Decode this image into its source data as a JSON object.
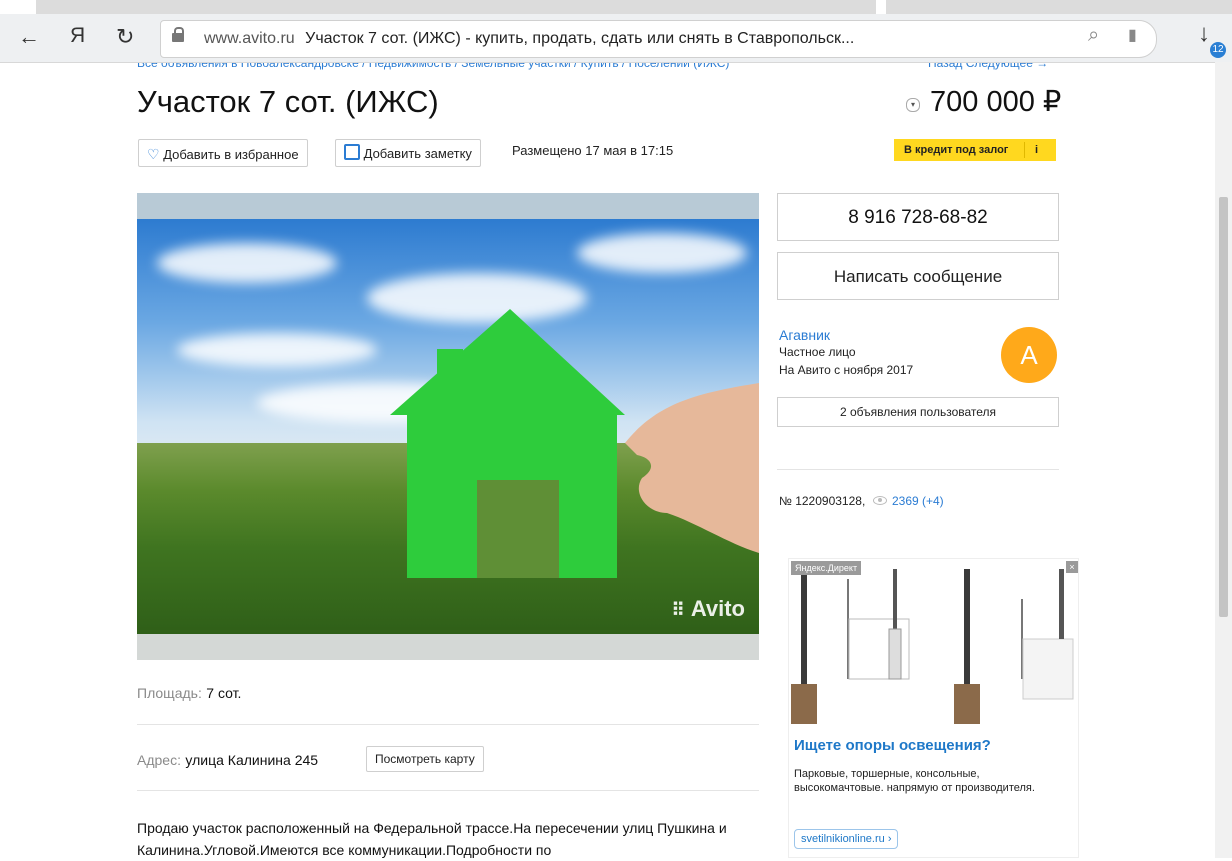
{
  "browser": {
    "back_icon": "←",
    "yandex_logo": "Я",
    "reload_icon": "↻",
    "url_domain": "www.avito.ru",
    "page_title": "Участок 7 сот. (ИЖС) - купить, продать, сдать или снять в Ставропольск...",
    "search_icon": "⌕",
    "bookmark_icon": "▮",
    "download_icon": "↓",
    "download_count": "12"
  },
  "page": {
    "breadcrumbs": "Все объявления в Новоалександровске / Недвижимость / Земельные участки / Купить / Поселений (ИЖС)",
    "nav": "Назад  Следующее →",
    "title": "Участок 7 сот. (ИЖС)",
    "price": "700 000 ₽",
    "price_toggle": "▾",
    "favorite_label": "Добавить в избранное",
    "note_label": "Добавить заметку",
    "posted": "Размещено 17 мая в 17:15",
    "credit_label": "В кредит под залог",
    "credit_info": "i",
    "photo_watermark": "Avito",
    "area_label": "Площадь:",
    "area_value": "7 сот.",
    "address_label": "Адрес:",
    "address_value": "улица Калинина 245",
    "map_button": "Посмотреть карту",
    "description": "Продаю участок расположенный на Федеральной трассе.На пересечении улиц Пушкина и Калинина.Угловой.Имеются все коммуникации.Подробности по"
  },
  "seller": {
    "phone": "8 916 728-68-82",
    "message_button": "Написать сообщение",
    "name": "Агавник",
    "type": "Частное лицо",
    "since": "На Авито с ноября 2017",
    "avatar_letter": "А",
    "ads_button": "2 объявления пользователя",
    "ad_number": "№ 1220903128,",
    "views": "2369 (+4)"
  },
  "ad": {
    "tag": "Яндекс.Директ",
    "close": "×",
    "title": "Ищете опоры освещения?",
    "text": "Парковые, торшерные, консольные, высокомачтовые. напрямую от производителя.",
    "link": "svetilnikionline.ru ›"
  },
  "colors": {
    "link": "#2b7cd3",
    "credit": "#ffd81f",
    "avatar": "#ffa91a"
  }
}
